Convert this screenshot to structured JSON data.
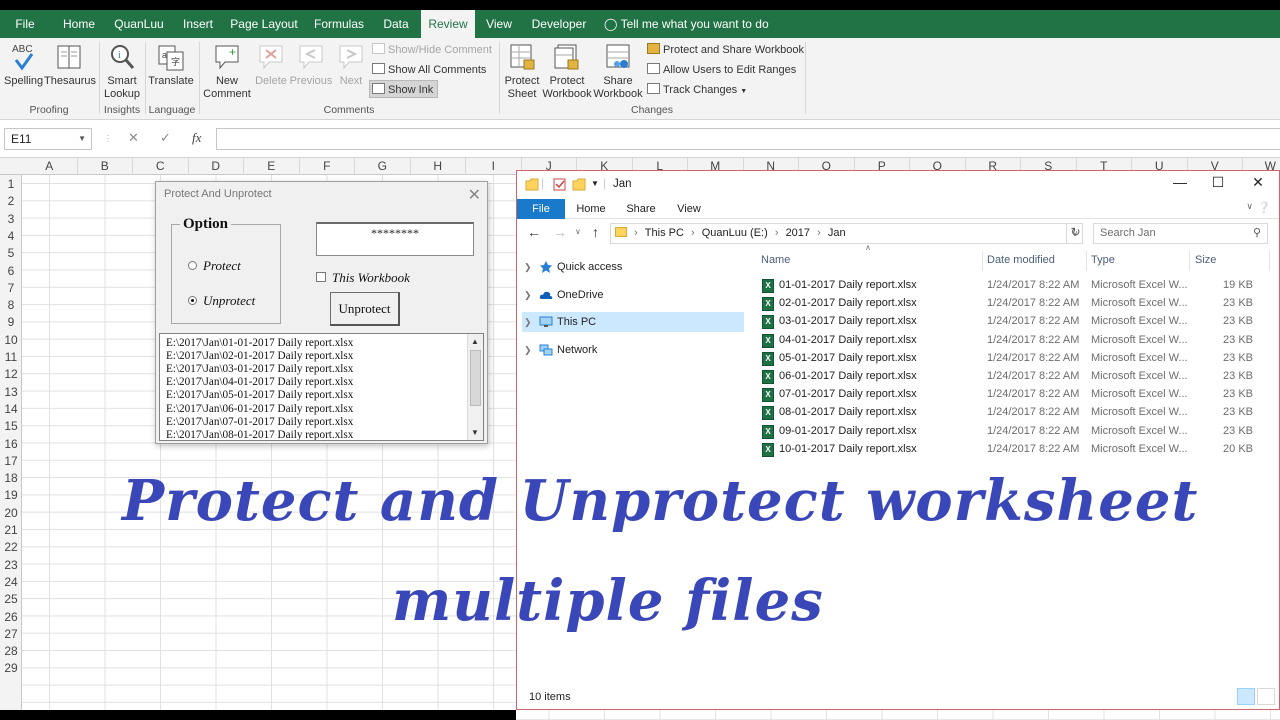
{
  "excel": {
    "tabs": [
      "File",
      "Home",
      "QuanLuu",
      "Insert",
      "Page Layout",
      "Formulas",
      "Data",
      "Review",
      "View",
      "Developer"
    ],
    "active_tab": "Review",
    "tell_me": "Tell me what you want to do",
    "ribbon": {
      "spelling": "Spelling",
      "spelling_abc": "ABC",
      "thesaurus": "Thesaurus",
      "smart_lookup_1": "Smart",
      "smart_lookup_2": "Lookup",
      "translate": "Translate",
      "new_comment_1": "New",
      "new_comment_2": "Comment",
      "delete": "Delete",
      "previous": "Previous",
      "next": "Next",
      "show_hide_comment": "Show/Hide Comment",
      "show_all_comments": "Show All Comments",
      "show_ink": "Show Ink",
      "protect_sheet_1": "Protect",
      "protect_sheet_2": "Sheet",
      "protect_workbook_1": "Protect",
      "protect_workbook_2": "Workbook",
      "share_workbook_1": "Share",
      "share_workbook_2": "Workbook",
      "protect_and_share": "Protect and Share Workbook",
      "allow_users": "Allow Users to Edit Ranges",
      "track_changes": "Track Changes",
      "groups": {
        "proofing": "Proofing",
        "insights": "Insights",
        "language": "Language",
        "comments": "Comments",
        "changes": "Changes"
      }
    },
    "name_box": "E11",
    "formula_icons": {
      "cancel": "✕",
      "enter": "✓",
      "fx": "fx"
    },
    "columns": [
      "A",
      "B",
      "C",
      "D",
      "E",
      "F",
      "G",
      "H",
      "I",
      "J",
      "K",
      "L",
      "M",
      "N",
      "O",
      "P",
      "Q",
      "R",
      "S",
      "T",
      "U",
      "V",
      "W"
    ],
    "rows": [
      "1",
      "2",
      "3",
      "4",
      "5",
      "6",
      "7",
      "8",
      "9",
      "10",
      "11",
      "12",
      "13",
      "14",
      "15",
      "16",
      "17",
      "18",
      "19",
      "20",
      "21",
      "22",
      "23",
      "24",
      "25",
      "26",
      "27",
      "28",
      "29"
    ]
  },
  "userform": {
    "title": "Protect And Unprotect",
    "option_label": "Option",
    "protect_label": "Protect",
    "unprotect_label": "Unprotect",
    "selected_option": "Unprotect",
    "password_value": "********",
    "this_workbook_label": "This Workbook",
    "this_workbook_checked": false,
    "button_label": "Unprotect",
    "files": [
      "E:\\2017\\Jan\\01-01-2017 Daily report.xlsx",
      "E:\\2017\\Jan\\02-01-2017 Daily report.xlsx",
      "E:\\2017\\Jan\\03-01-2017 Daily report.xlsx",
      "E:\\2017\\Jan\\04-01-2017 Daily report.xlsx",
      "E:\\2017\\Jan\\05-01-2017 Daily report.xlsx",
      "E:\\2017\\Jan\\06-01-2017 Daily report.xlsx",
      "E:\\2017\\Jan\\07-01-2017 Daily report.xlsx",
      "E:\\2017\\Jan\\08-01-2017 Daily report.xlsx"
    ]
  },
  "explorer": {
    "title": "Jan",
    "tabs": [
      "File",
      "Home",
      "Share",
      "View"
    ],
    "breadcrumb": [
      "This PC",
      "QuanLuu (E:)",
      "2017",
      "Jan"
    ],
    "search_placeholder": "Search Jan",
    "nav": [
      {
        "label": "Quick access",
        "icon": "star-icon"
      },
      {
        "label": "OneDrive",
        "icon": "cloud-icon"
      },
      {
        "label": "This PC",
        "icon": "computer-icon",
        "selected": true
      },
      {
        "label": "Network",
        "icon": "network-icon"
      }
    ],
    "columns": {
      "name": "Name",
      "date": "Date modified",
      "type": "Type",
      "size": "Size"
    },
    "files": [
      {
        "name": "01-01-2017 Daily report.xlsx",
        "date": "1/24/2017 8:22 AM",
        "type": "Microsoft Excel W...",
        "size": "19 KB"
      },
      {
        "name": "02-01-2017 Daily report.xlsx",
        "date": "1/24/2017 8:22 AM",
        "type": "Microsoft Excel W...",
        "size": "23 KB"
      },
      {
        "name": "03-01-2017 Daily report.xlsx",
        "date": "1/24/2017 8:22 AM",
        "type": "Microsoft Excel W...",
        "size": "23 KB"
      },
      {
        "name": "04-01-2017 Daily report.xlsx",
        "date": "1/24/2017 8:22 AM",
        "type": "Microsoft Excel W...",
        "size": "23 KB"
      },
      {
        "name": "05-01-2017 Daily report.xlsx",
        "date": "1/24/2017 8:22 AM",
        "type": "Microsoft Excel W...",
        "size": "23 KB"
      },
      {
        "name": "06-01-2017 Daily report.xlsx",
        "date": "1/24/2017 8:22 AM",
        "type": "Microsoft Excel W...",
        "size": "23 KB"
      },
      {
        "name": "07-01-2017 Daily report.xlsx",
        "date": "1/24/2017 8:22 AM",
        "type": "Microsoft Excel W...",
        "size": "23 KB"
      },
      {
        "name": "08-01-2017 Daily report.xlsx",
        "date": "1/24/2017 8:22 AM",
        "type": "Microsoft Excel W...",
        "size": "23 KB"
      },
      {
        "name": "09-01-2017 Daily report.xlsx",
        "date": "1/24/2017 8:22 AM",
        "type": "Microsoft Excel W...",
        "size": "23 KB"
      },
      {
        "name": "10-01-2017 Daily report.xlsx",
        "date": "1/24/2017 8:22 AM",
        "type": "Microsoft Excel W...",
        "size": "20 KB"
      }
    ],
    "item_count": "10 items"
  },
  "caption": {
    "line1": "Protect and Unprotect worksheet",
    "line2": "multiple files"
  },
  "colors": {
    "excel_green": "#217346",
    "explorer_blue": "#1979ca",
    "caption_blue": "#3a47b8",
    "selection_blue": "#cce8ff"
  }
}
